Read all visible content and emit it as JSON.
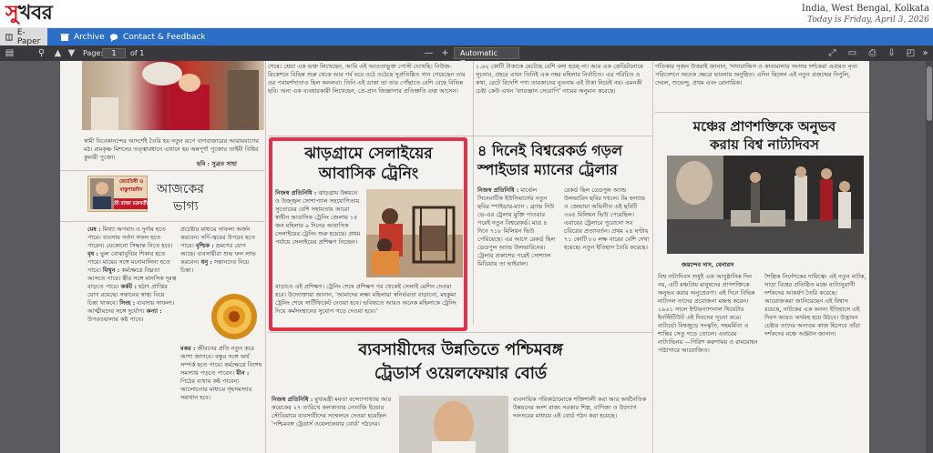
{
  "masthead": {
    "logo": "সুখবর",
    "location": "India, West Bengal, Kolkata",
    "date_line": "Today is Friday, April 3, 2026"
  },
  "nav": {
    "items": [
      {
        "label": "E-Paper",
        "icon": "book-icon"
      },
      {
        "label": "Archive",
        "icon": "archive-icon"
      },
      {
        "label": "Contact & Feedback",
        "icon": "chat-icon"
      }
    ]
  },
  "pdf_toolbar": {
    "page_label": "Page:",
    "page_value": "1",
    "page_total": "of 1",
    "zoom_value": "Automatic Zoom",
    "zoom_out": "—",
    "zoom_in": "+"
  },
  "newspaper": {
    "main_headline_1": "ঝাড়গ্রামে সেলাইয়ের",
    "main_headline_2": "আবাসিক ট্রেনিং",
    "spider_headline_1": "৪ দিনেই বিশ্বরেকর্ড গড়ল",
    "spider_headline_2": "স্পাইডার ম্যানের ট্রেলার",
    "horoscope_title_1": "আজকের",
    "horoscope_title_2": "ভাগ্য",
    "horoscope_box_line1": "জ্যোতিষী ও",
    "horoscope_box_line2": "বাস্তুশাস্ত্রবিদ",
    "horoscope_box_name": "শ্রী রাজা চক্রবর্তী",
    "theatre_headline_1": "মঞ্চের প্রাণশক্তিকে অনুভব",
    "theatre_headline_2": "করায় বিশ্ব নাট্যদিবস",
    "theatre_byline": "জয়ন্দেব দাস, বেনারস",
    "traders_headline_1": "ব্যবসায়ীদের উন্নতিতে পশ্চিমবঙ্গ",
    "traders_headline_2": "ট্রেডার্স ওয়েলফেয়ার বোর্ড",
    "top_caption": "স্বামী বিবেকানন্দের আদর্শেই তৈরি হয় নতুন রূপে বাগবাজারের আরামবাগের মঠ। রামকৃষ্ণ মিশনের তত্ত্বাবধানে এখানে হয় অন্নপূর্ণা পুজোর তাইমী বিধির কুমারী পুজো।",
    "top_caption_credit": "ছবি : সুব্রত সাহা",
    "zodiac_mesh": "মেষ :",
    "zodiac_brish": "বৃষ :",
    "zodiac_mithun": "মিথুন :",
    "zodiac_karkat": "কর্কট :",
    "zodiac_singha": "সিংহ :",
    "zodiac_kanya": "কন্যা :",
    "zodiac_brishchik": "বৃশ্চিক :",
    "zodiac_dhanu": "ধনু :",
    "zodiac_makar": "মকর :",
    "zodiac_meen": "মীন :",
    "spider_lead": "নিজস্ব প্রতিনিধি :",
    "jhargram_lead": "নিজস্ব প্রতিনিধি :",
    "traders_lead": "নিজস্ব প্রতিনিধি :"
  }
}
